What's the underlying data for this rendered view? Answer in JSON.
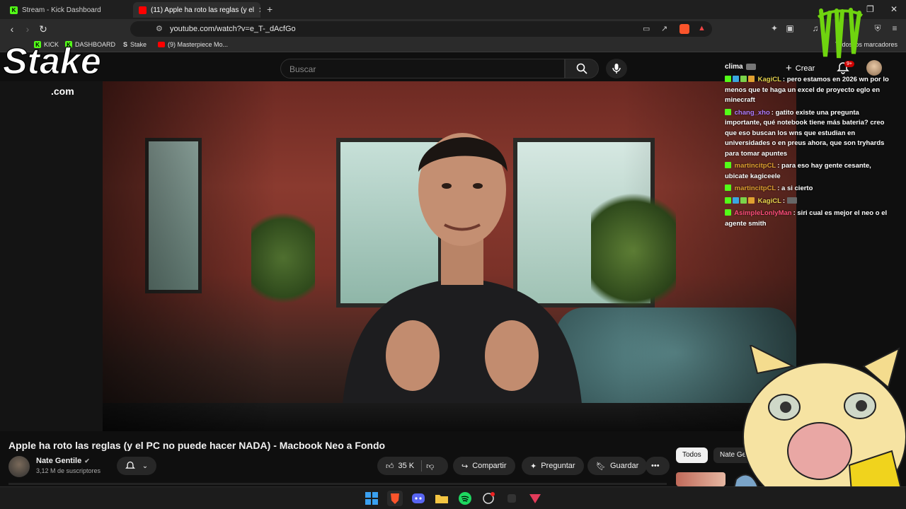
{
  "browser": {
    "tabs": [
      {
        "title": "Stream - Kick Dashboard",
        "favicon": "kick-icon",
        "color": "#53fc18"
      },
      {
        "title": "(11) Apple ha roto las reglas (y el",
        "favicon": "youtube-icon",
        "color": "#ff0000"
      }
    ],
    "new_tab": "+",
    "url": "youtube.com/watch?v=e_T-_dAcfGo",
    "bookmarks": [
      {
        "label": "KICK",
        "icon": "kick-icon"
      },
      {
        "label": "DASHBOARD",
        "icon": "kick-icon"
      },
      {
        "label": "Stake",
        "icon": "stake-icon"
      },
      {
        "label": "(9) Masterpiece Mo...",
        "icon": "youtube-icon"
      }
    ],
    "bookmarks_right": "Todos los marcadores"
  },
  "youtube": {
    "search_placeholder": "Buscar",
    "create_label": "Crear",
    "notifications_badge": "9+",
    "video": {
      "title": "Apple ha roto las reglas (y el PC no puede hacer NADA) - Macbook Neo a Fondo",
      "channel": "Nate Gentile",
      "subscribers": "3,12 M de suscriptores",
      "likes": "35 K",
      "share_label": "Compartir",
      "ask_label": "Preguntar",
      "save_label": "Guardar",
      "more_label": "•••"
    },
    "chips": [
      "Todos",
      "Nate Ge"
    ]
  },
  "overlay": {
    "stake_logo": "Stake",
    "stake_sub": ".com",
    "chat_header": "clima",
    "chat": [
      {
        "user": "KagiCL",
        "user_color": "#e8d44d",
        "text": ": pero estamos en 2026 wn por lo menos que te haga un excel de proyecto eglo en minecraft"
      },
      {
        "user": "chang_xho",
        "user_color": "#b07cff",
        "text": ": gatito existe una pregunta importante, qué notebook tiene más bateria? creo que eso buscan los wns que estudian en universidades o en preus ahora, que son tryhards para tomar apuntes"
      },
      {
        "user": "martincitpCL",
        "user_color": "#e0a030",
        "text": ": para eso hay gente cesante, ubicate kagiceele"
      },
      {
        "user": "martincitpCL",
        "user_color": "#e0a030",
        "text": ": a si cierto"
      },
      {
        "user": "KagiCL",
        "user_color": "#e8d44d",
        "text": ":"
      },
      {
        "user": "AsimpleLonlyMan",
        "user_color": "#ff4d7a",
        "text": ": siri cual es mejor el neo o el agente smith"
      }
    ]
  },
  "taskbar": {
    "apps": [
      "windows-start-icon",
      "brave-icon",
      "discord-icon",
      "file-explorer-icon",
      "spotify-icon",
      "app-icon",
      "app-icon-2",
      "app-icon-3"
    ]
  }
}
